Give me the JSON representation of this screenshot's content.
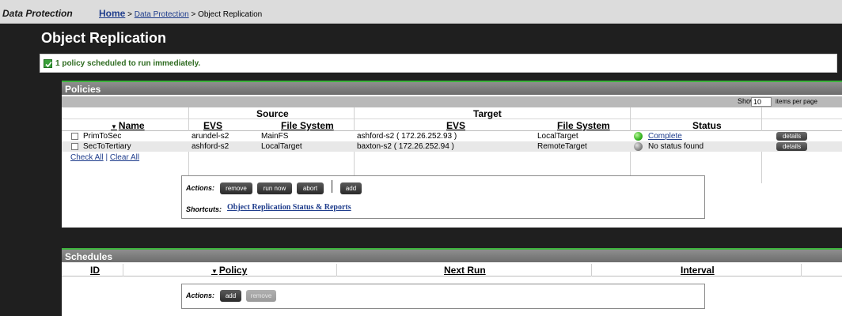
{
  "breadcrumb": {
    "section": "Data Protection",
    "home": "Home",
    "sep1": ">",
    "link": "Data Protection",
    "sep2": ">",
    "current": "Object Replication"
  },
  "page_title": "Object Replication",
  "message": {
    "icon": "check-icon",
    "text": "1 policy scheduled to run immediately."
  },
  "policies": {
    "title": "Policies",
    "show_label": "Show",
    "per_page_value": "10",
    "per_page_suffix": "items per page",
    "group_source": "Source",
    "group_target": "Target",
    "columns": {
      "name": "Name",
      "src_evs": "EVS",
      "src_fs": "File System",
      "tgt_evs": "EVS",
      "tgt_fs": "File System",
      "status": "Status"
    },
    "rows": [
      {
        "name": "PrimToSec",
        "src_evs": "arundel-s2",
        "src_fs": "MainFS",
        "tgt_evs": "ashford-s2 ( 172.26.252.93 )",
        "tgt_fs": "LocalTarget",
        "status": "Complete",
        "status_color": "#35b320",
        "details": "details"
      },
      {
        "name": "SecToTertiary",
        "src_evs": "ashford-s2",
        "src_fs": "LocalTarget",
        "tgt_evs": "baxton-s2 ( 172.26.252.94 )",
        "tgt_fs": "RemoteTarget",
        "status": "No status found",
        "status_color": "#888888",
        "details": "details"
      }
    ],
    "check_all": "Check All",
    "separator": "|",
    "clear_all": "Clear All",
    "actions_label": "Actions:",
    "actions": [
      "remove",
      "run now",
      "abort",
      "add"
    ],
    "shortcuts_label": "Shortcuts:",
    "shortcut": "Object Replication Status & Reports"
  },
  "schedules": {
    "title": "Schedules",
    "columns": {
      "id": "ID",
      "policy": "Policy",
      "next_run": "Next Run",
      "interval": "Interval"
    },
    "actions_label": "Actions:",
    "actions": [
      "add",
      "remove"
    ]
  },
  "colors": {
    "accent_green": "#3cb43c",
    "link_blue": "#1f3d8c",
    "message_green": "#2e6b20"
  }
}
